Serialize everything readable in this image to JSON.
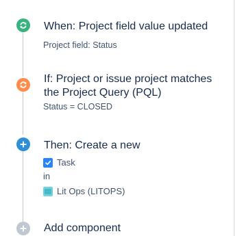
{
  "colors": {
    "trigger": "#36b37e",
    "condition": "#ff8b4d",
    "action": "#2d8fd5",
    "add": "#c1c7d0",
    "connector": "#c1c7d0"
  },
  "steps": [
    {
      "icon": "refresh-icon",
      "title": "When: Project field value updated",
      "details": [
        "Project field: Status"
      ]
    },
    {
      "icon": "refresh-icon",
      "title_lines": [
        "If: Project or issue project matches",
        "the Project Query (PQL)"
      ],
      "details": [
        "Status = CLOSED"
      ]
    },
    {
      "icon": "plus-icon",
      "title": "Then: Create a new",
      "issue_type": "Task",
      "in_label": "in",
      "project": "Lit Ops (LITOPS)"
    }
  ],
  "add_component": {
    "icon": "plus-icon",
    "label": "Add component"
  }
}
